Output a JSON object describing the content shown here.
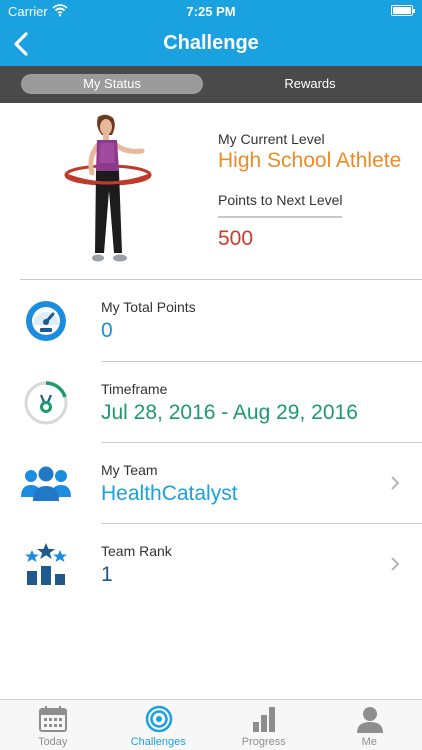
{
  "status_bar": {
    "carrier": "Carrier",
    "time": "7:25 PM"
  },
  "nav": {
    "title": "Challenge"
  },
  "segments": {
    "active": "My Status",
    "inactive": "Rewards"
  },
  "level": {
    "current_label": "My Current Level",
    "current_value": "High School Athlete",
    "next_label": "Points to Next Level",
    "next_value": "500"
  },
  "rows": [
    {
      "label": "My Total Points",
      "value": "0",
      "icon": "gauge-icon"
    },
    {
      "label": "Timeframe",
      "value": "Jul 28, 2016 - Aug 29, 2016",
      "icon": "timer-medal-icon"
    },
    {
      "label": "My Team",
      "value": "HealthCatalyst",
      "icon": "team-icon"
    },
    {
      "label": "Team Rank",
      "value": "1",
      "icon": "rank-podium-icon"
    }
  ],
  "tabs": [
    {
      "label": "Today",
      "icon": "calendar-icon"
    },
    {
      "label": "Challenges",
      "icon": "target-icon"
    },
    {
      "label": "Progress",
      "icon": "bar-chart-icon"
    },
    {
      "label": "Me",
      "icon": "person-icon"
    }
  ],
  "colors": {
    "brand_blue": "#1aa1e0",
    "level_orange": "#f08a24",
    "points_red": "#d0392d",
    "dark_blue": "#1f5a8c",
    "timeframe_green": "#1d9a6c"
  }
}
